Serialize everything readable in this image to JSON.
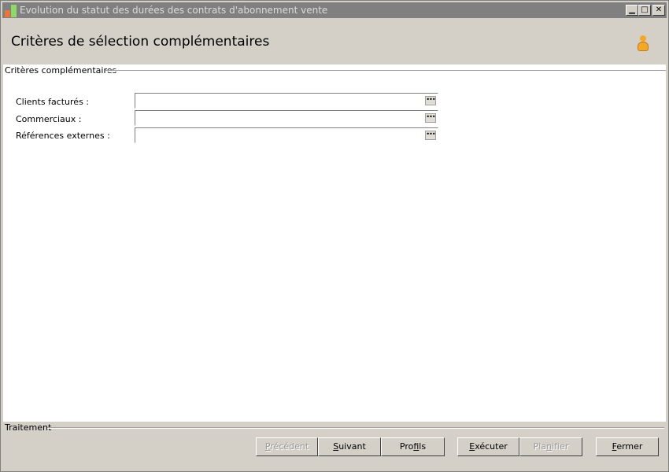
{
  "window": {
    "title": "Evolution du statut des durées des contrats d'abonnement vente"
  },
  "header": {
    "title": "Critères de sélection complémentaires"
  },
  "group": {
    "label": "Critères complémentaires"
  },
  "fields": [
    {
      "label": "Clients facturés :",
      "value": ""
    },
    {
      "label": "Commerciaux :",
      "value": ""
    },
    {
      "label": "Références externes :",
      "value": ""
    }
  ],
  "field_button_label": "•••",
  "footer": {
    "label": "Traitement",
    "buttons": {
      "precedent": {
        "pre": "",
        "key": "P",
        "post": "récédent",
        "enabled": false
      },
      "suivant": {
        "pre": "",
        "key": "S",
        "post": "uivant",
        "enabled": true
      },
      "profils": {
        "pre": "Pro",
        "key": "f",
        "post": "ils",
        "enabled": true
      },
      "executer": {
        "pre": "",
        "key": "E",
        "post": "xécuter",
        "enabled": true
      },
      "planifier": {
        "pre": "Pla",
        "key": "n",
        "post": "ifier",
        "enabled": false
      },
      "fermer": {
        "pre": "",
        "key": "F",
        "post": "ermer",
        "enabled": true
      }
    }
  },
  "colors": {
    "titlebar": "#808080",
    "background": "#d4d0c8",
    "accent_icon": "#f4a82a"
  }
}
